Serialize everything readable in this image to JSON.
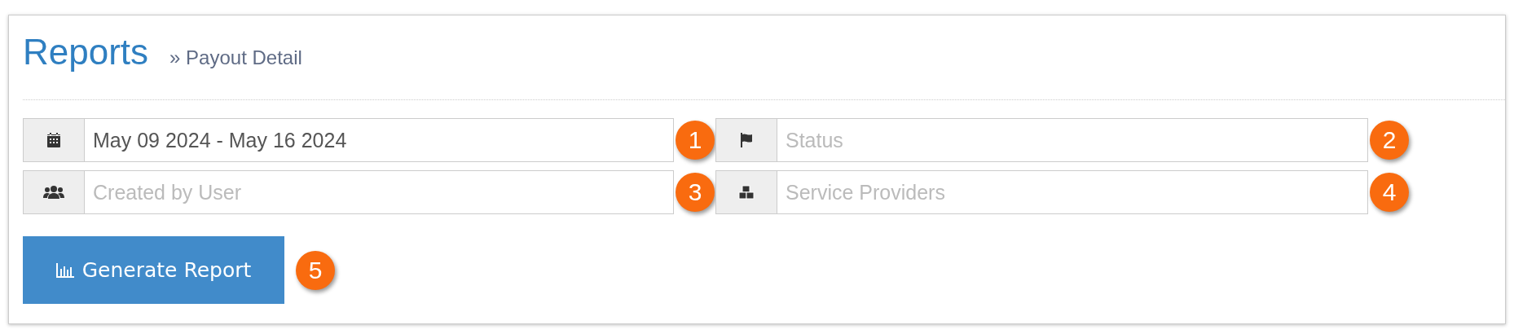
{
  "header": {
    "title": "Reports",
    "breadcrumb": "» Payout Detail"
  },
  "fields": [
    {
      "value": "May 09 2024 - May 16 2024",
      "badge": "1"
    },
    {
      "placeholder": "Status",
      "badge": "2"
    },
    {
      "placeholder": "Created by User",
      "badge": "3"
    },
    {
      "placeholder": "Service Providers",
      "badge": "4"
    }
  ],
  "button": {
    "label": "Generate Report",
    "badge": "5"
  }
}
